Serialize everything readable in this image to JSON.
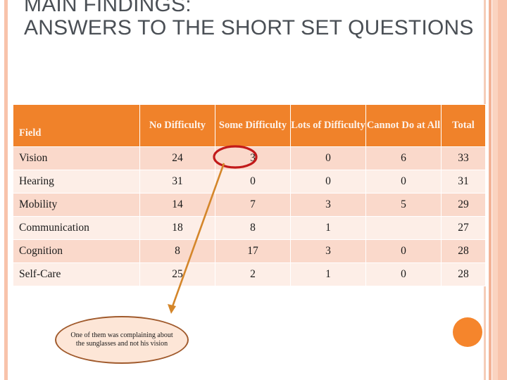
{
  "slide": {
    "title": "MAIN FINDINGS:\nANSWERS TO THE SHORT SET QUESTIONS",
    "title_color": "#4a4f55",
    "background_color": "#ffffff"
  },
  "theme": {
    "header_orange": "#f0822a",
    "row_odd": "#fad9cb",
    "row_even": "#fdeee7",
    "stripe_light": "#f8c3ab",
    "accent_dot": "#f5852c",
    "callout_border": "#a05a2c",
    "callout_fill": "#fde6d7",
    "highlight_ring": "#c21a1a",
    "leader_line": "#d4862a"
  },
  "table": {
    "headers": [
      "Field",
      "No Difficulty",
      "Some Difficulty",
      "Lots of Difficulty",
      "Cannot Do at All",
      "Total"
    ],
    "rows": [
      {
        "field": "Vision",
        "no_difficulty": "24",
        "some_difficulty": "3",
        "lots_of_difficulty": "0",
        "cannot_do_at_all": "6",
        "total": "33"
      },
      {
        "field": "Hearing",
        "no_difficulty": "31",
        "some_difficulty": "0",
        "lots_of_difficulty": "0",
        "cannot_do_at_all": "0",
        "total": "31"
      },
      {
        "field": "Mobility",
        "no_difficulty": "14",
        "some_difficulty": "7",
        "lots_of_difficulty": "3",
        "cannot_do_at_all": "5",
        "total": "29"
      },
      {
        "field": "Communication",
        "no_difficulty": "18",
        "some_difficulty": "8",
        "lots_of_difficulty": "1",
        "cannot_do_at_all": "",
        "total": "27"
      },
      {
        "field": "Cognition",
        "no_difficulty": "8",
        "some_difficulty": "17",
        "lots_of_difficulty": "3",
        "cannot_do_at_all": "0",
        "total": "28"
      },
      {
        "field": "Self-Care",
        "no_difficulty": "25",
        "some_difficulty": "2",
        "lots_of_difficulty": "1",
        "cannot_do_at_all": "0",
        "total": "28"
      }
    ]
  },
  "annotations": {
    "highlighted_cell": {
      "row": "Vision",
      "column": "Some Difficulty",
      "value": "3"
    },
    "callout_text": "One of them was complaining about the sunglasses and not his vision"
  }
}
